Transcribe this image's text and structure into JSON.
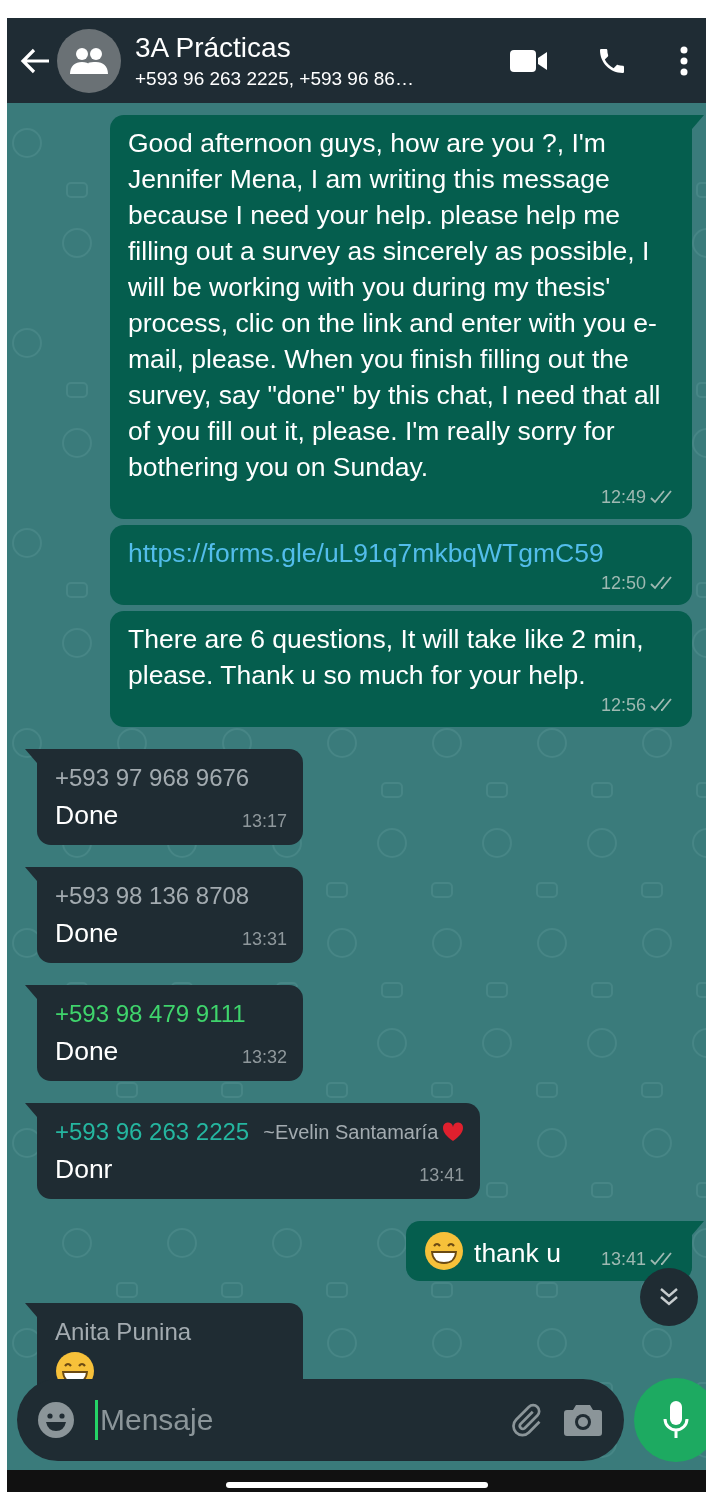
{
  "header": {
    "title": "3A Prácticas",
    "subtitle": "+593 96 263 2225, +593 96 86…"
  },
  "messages": [
    {
      "outgoing": true,
      "tail": true,
      "text": "Good afternoon guys, how are you ?, I'm Jennifer Mena, I am writing this message because I need your help. please help me filling out a survey as sincerely as possible, I will be working with you during my thesis' process, clic on the link and enter with you e-mail, please. When you finish filling out the survey, say \"done\" by this chat, I need that all of you fill out it, please. I'm really sorry for bothering you on Sunday.",
      "time": "12:49",
      "read": false
    },
    {
      "outgoing": true,
      "tail": false,
      "kind": "link",
      "text": "https://forms.gle/uL91q7mkbqWTgmC59",
      "time": "12:50",
      "read": false
    },
    {
      "outgoing": true,
      "tail": false,
      "text": "There are 6 questions, It will take like 2 min, please. Thank u so much for your help.",
      "time": "12:56",
      "read": false
    },
    {
      "outgoing": false,
      "tail": true,
      "sender": "+593 97 968 9676",
      "color": "#a3abb0",
      "text": "Done",
      "time": "13:17"
    },
    {
      "outgoing": false,
      "tail": true,
      "sender": "+593 98 136 8708",
      "color": "#a3abb0",
      "text": "Done",
      "time": "13:31"
    },
    {
      "outgoing": false,
      "tail": true,
      "sender": "+593 98 479 9111",
      "color": "#3fd46c",
      "text": "Done",
      "time": "13:32"
    },
    {
      "outgoing": false,
      "tail": true,
      "sender": "+593 96 263 2225",
      "color": "#25b6a0",
      "push_name": "~Evelin Santamaría",
      "push_heart": true,
      "text": "Donr",
      "time": "13:41"
    },
    {
      "outgoing": true,
      "tail": true,
      "emoji": true,
      "text": "thank u",
      "time": "13:41",
      "read": false
    },
    {
      "outgoing": false,
      "tail": true,
      "sender": "Anita Punina",
      "color": "#a3abb0",
      "emoji": true
    }
  ],
  "composer": {
    "placeholder": "Mensaje"
  }
}
